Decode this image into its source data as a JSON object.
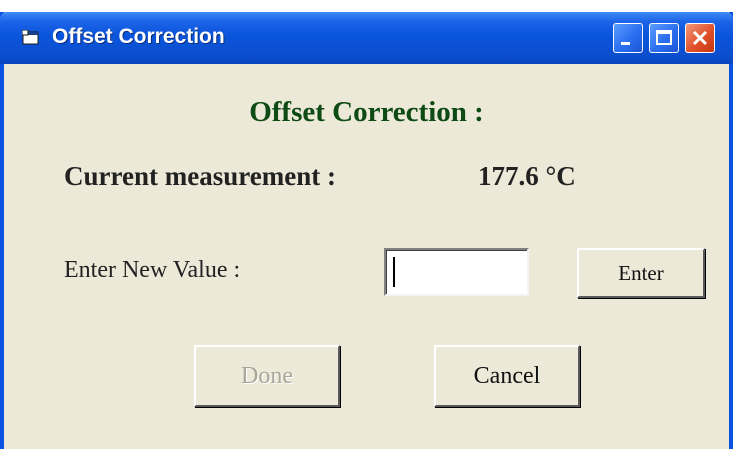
{
  "window": {
    "title": "Offset Correction",
    "icon": "app-window-icon"
  },
  "titlebar_buttons": {
    "minimize_icon": "minimize-icon",
    "maximize_icon": "maximize-icon",
    "close_icon": "close-icon"
  },
  "form": {
    "heading": "Offset Correction :",
    "current_label": "Current measurement :",
    "current_value": "177.6 °C",
    "new_value_label": "Enter New Value :",
    "new_value_input": "",
    "enter_button": "Enter",
    "done_button": "Done",
    "done_enabled": false,
    "cancel_button": "Cancel"
  },
  "colors": {
    "titlebar": "#0A55DC",
    "heading": "#0E4A13",
    "dialog_bg": "#ECE9D8",
    "close_button": "#E1502A",
    "disabled_text": "#A8A699"
  }
}
